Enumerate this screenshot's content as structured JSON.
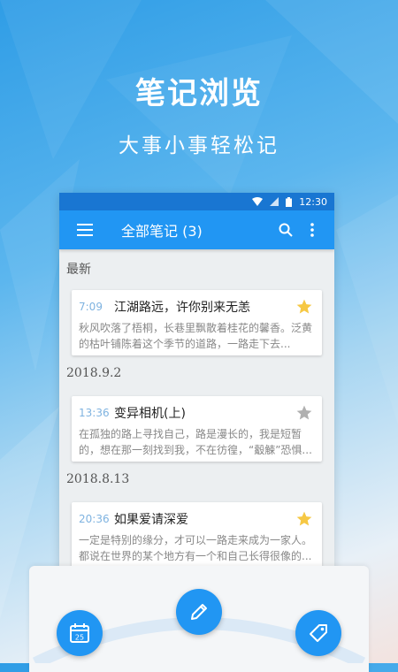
{
  "hero": {
    "title": "笔记浏览",
    "subtitle": "大事小事轻松记"
  },
  "status": {
    "time": "12:30"
  },
  "toolbar": {
    "title": "全部笔记 (3)"
  },
  "groups": [
    {
      "label": "最新",
      "notes": [
        {
          "time": "7:09",
          "title": "江湖路远，许你别来无恙",
          "starred": true,
          "excerpt": "秋风吹落了梧桐，长巷里飘散着桂花的馨香。泛黄的枯叶铺陈着这个季节的道路，一路走下去..."
        }
      ]
    },
    {
      "label": "2018.9.2",
      "notes": [
        {
          "time": "13:36",
          "title": "变异相机(上)",
          "starred": false,
          "excerpt": "在孤独的路上寻找自己，路是漫长的，我是短暂的，想在那一刻找到我，不在彷徨，“觳觫”恐惧..."
        }
      ]
    },
    {
      "label": "2018.8.13",
      "notes": [
        {
          "time": "20:36",
          "title": "如果爱请深爱",
          "starred": true,
          "excerpt": "一定是特别的缘分，才可以一路走来成为一家人。都说在世界的某个地方有一个和自己长得很像的..."
        }
      ]
    }
  ],
  "icons": {
    "menu": "menu-icon",
    "search": "search-icon",
    "more": "more-vert-icon",
    "calendar": "calendar-icon",
    "edit": "pencil-icon",
    "tag": "tag-icon",
    "star_on": "star-filled-icon",
    "star_off": "star-outline-icon"
  },
  "colors": {
    "primary": "#2196f3",
    "primary_dark": "#1976d2",
    "star": "#f6c844",
    "star_off": "#b0b0b0",
    "time": "#7fb3e0"
  }
}
